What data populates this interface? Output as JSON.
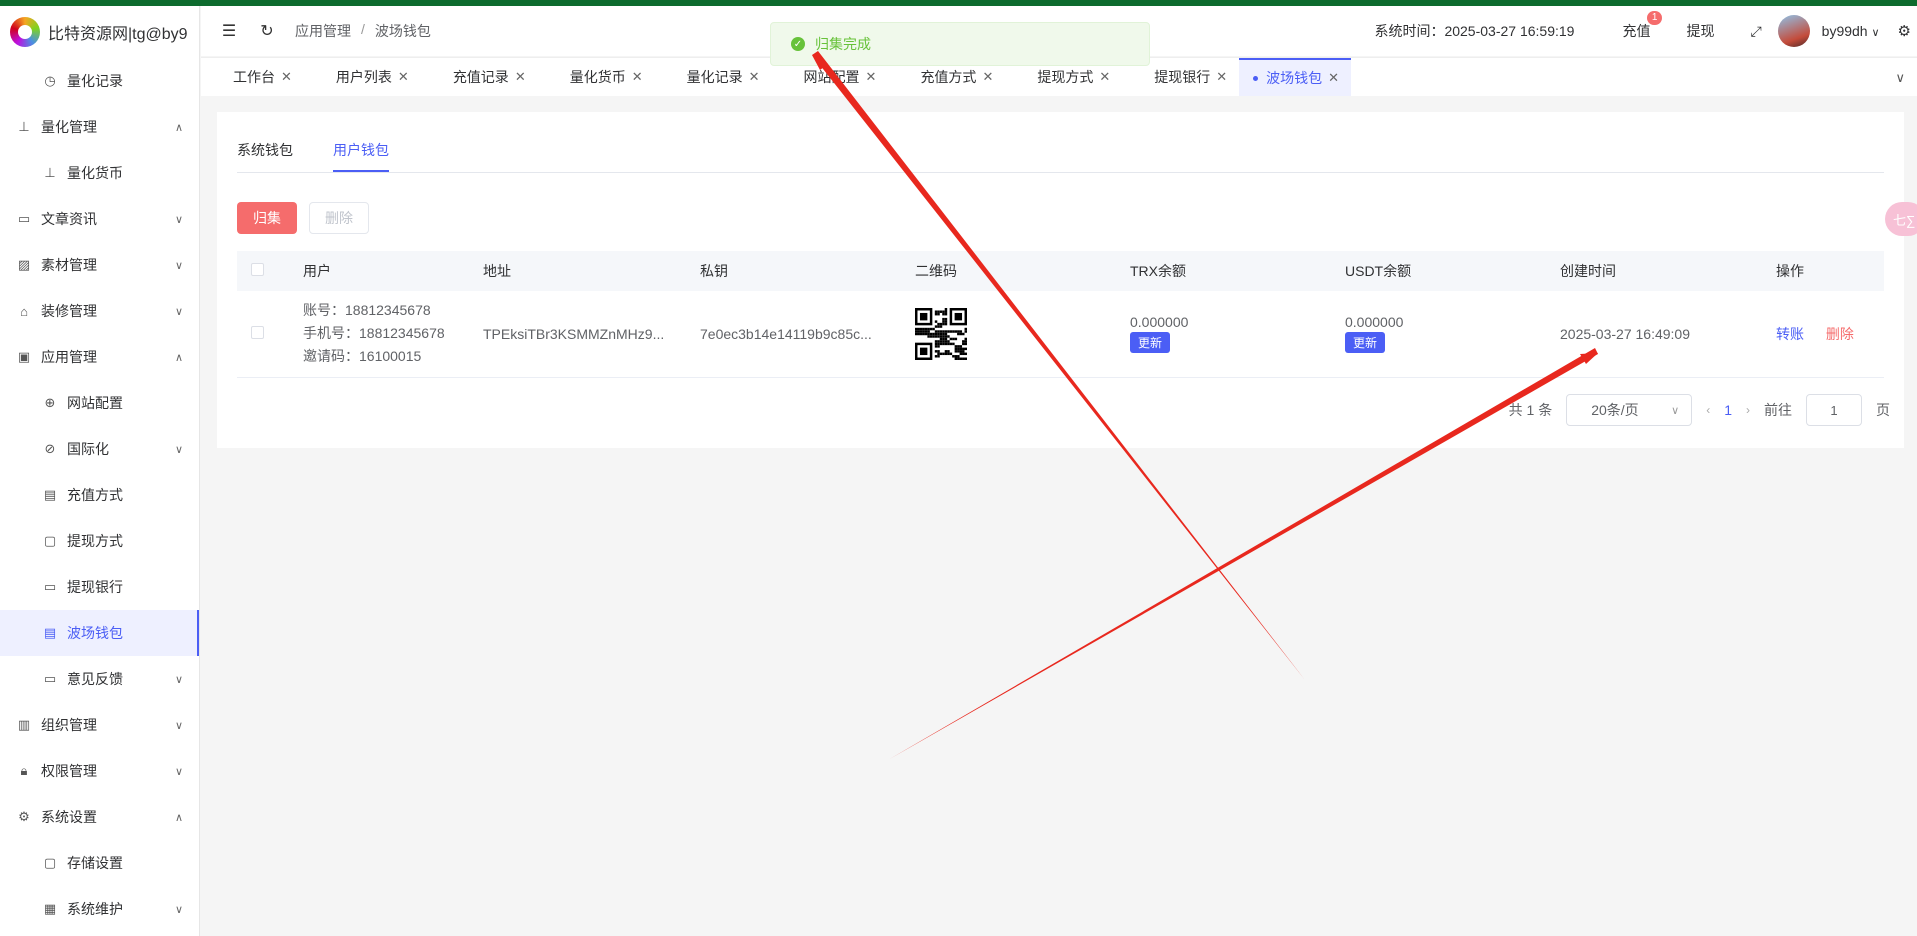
{
  "app": {
    "title": "比特资源网|tg@by9"
  },
  "sidebar": {
    "items": [
      {
        "label": "量化记录",
        "icon": "clock-icon",
        "sub": true
      },
      {
        "label": "量化管理",
        "icon": "chart-icon",
        "arrow": "up"
      },
      {
        "label": "量化货币",
        "icon": "chart-icon",
        "sub": true
      },
      {
        "label": "文章资讯",
        "icon": "message-icon",
        "arrow": "down"
      },
      {
        "label": "素材管理",
        "icon": "picture-icon",
        "arrow": "down"
      },
      {
        "label": "装修管理",
        "icon": "decoration-icon",
        "arrow": "down"
      },
      {
        "label": "应用管理",
        "icon": "app-icon",
        "arrow": "up"
      },
      {
        "label": "网站配置",
        "icon": "globe-icon",
        "sub": true
      },
      {
        "label": "国际化",
        "icon": "i18n-icon",
        "sub": true,
        "arrow": "down"
      },
      {
        "label": "充值方式",
        "icon": "wallet-icon",
        "sub": true
      },
      {
        "label": "提现方式",
        "icon": "folder-icon",
        "sub": true
      },
      {
        "label": "提现银行",
        "icon": "card-icon",
        "sub": true
      },
      {
        "label": "波场钱包",
        "icon": "wallet-icon",
        "sub": true,
        "active": true
      },
      {
        "label": "意见反馈",
        "icon": "message-icon",
        "sub": true,
        "arrow": "down"
      },
      {
        "label": "组织管理",
        "icon": "building-icon",
        "arrow": "down"
      },
      {
        "label": "权限管理",
        "icon": "lock-icon",
        "arrow": "down"
      },
      {
        "label": "系统设置",
        "icon": "gear-icon",
        "arrow": "up"
      },
      {
        "label": "存储设置",
        "icon": "folder-icon",
        "sub": true
      },
      {
        "label": "系统维护",
        "icon": "monitor-icon",
        "sub": true,
        "arrow": "down"
      }
    ]
  },
  "header": {
    "breadcrumb": [
      "应用管理",
      "波场钱包"
    ],
    "system_time": "系统时间：2025-03-27 16:59:19",
    "recharge": "充值",
    "recharge_badge": "1",
    "withdraw": "提现",
    "username": "by99dh"
  },
  "tabs": [
    {
      "label": "工作台"
    },
    {
      "label": "用户列表"
    },
    {
      "label": "充值记录"
    },
    {
      "label": "量化货币"
    },
    {
      "label": "量化记录"
    },
    {
      "label": "网站配置"
    },
    {
      "label": "充值方式"
    },
    {
      "label": "提现方式"
    },
    {
      "label": "提现银行"
    },
    {
      "label": "波场钱包",
      "active": true
    }
  ],
  "toast": {
    "text": "归集完成"
  },
  "content": {
    "subtabs": [
      "系统钱包",
      "用户钱包"
    ],
    "active_subtab": "用户钱包",
    "collect_button": "归集",
    "delete_button": "删除",
    "side_float": "七∑"
  },
  "table": {
    "headers": [
      "用户",
      "地址",
      "私钥",
      "二维码",
      "TRX余额",
      "USDT余额",
      "创建时间",
      "操作"
    ],
    "rows": [
      {
        "account": "账号：18812345678",
        "phone": "手机号：18812345678",
        "invite": "邀请码：16100015",
        "address": "TPEksiTBr3KSMMZnMHz9...",
        "private_key": "7e0ec3b14e14119b9c85c...",
        "trx": "0.000000",
        "usdt": "0.000000",
        "update": "更新",
        "created": "2025-03-27 16:49:09",
        "transfer": "转账",
        "delete": "删除"
      }
    ]
  },
  "pagination": {
    "total": "共 1 条",
    "page_size": "20条/页",
    "current_page": "1",
    "goto_label": "前往",
    "goto_value": "1",
    "page_suffix": "页"
  },
  "colors": {
    "accent": "#4b5ef5",
    "danger": "#f56c6c",
    "success": "#67c23a",
    "annotation": "#e8281e"
  }
}
